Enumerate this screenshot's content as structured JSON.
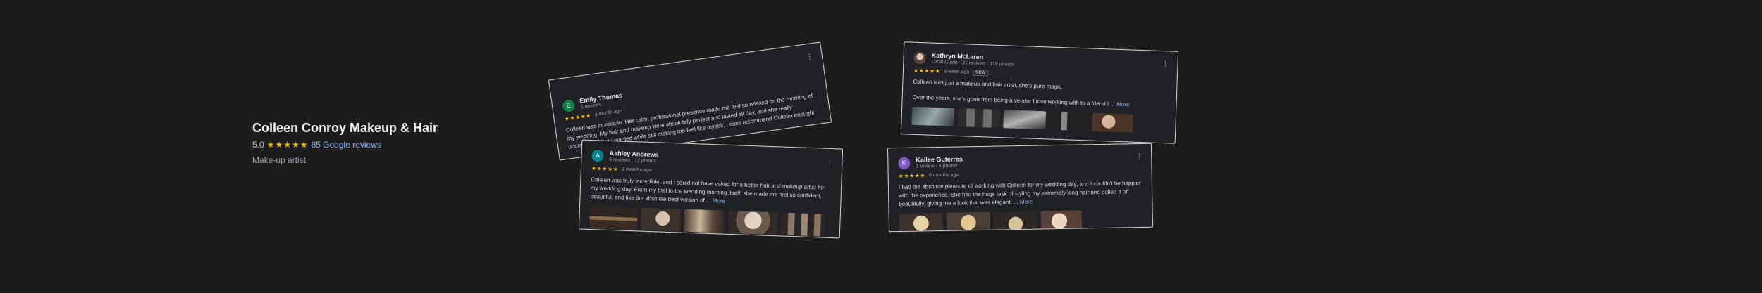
{
  "business": {
    "name": "Colleen Conroy Makeup & Hair",
    "rating": "5.0",
    "stars": "★★★★★",
    "reviews_link": "85 Google reviews",
    "category": "Make-up artist"
  },
  "reviews": [
    {
      "initial": "E",
      "avatar_color": "#0b8043",
      "name": "Emily Thomas",
      "meta": "5 reviews",
      "stars": "★★★★★",
      "date": "a month ago",
      "text": "Colleen was incredible. Her calm, professional presence made me feel so relaxed on the morning of my wedding. My hair and makeup were absolutely perfect and lasted all day, and she really understood what I wanted while still making me feel like myself. I can't recommend Colleen enough!",
      "more": ""
    },
    {
      "initial": "A",
      "avatar_color": "#00838f",
      "name": "Ashley Andrews",
      "meta": "6 reviews · 12 photos",
      "stars": "★★★★★",
      "date": "2 months ago",
      "text": "Colleen was truly incredible, and I could not have asked for a better hair and makeup artist for my wedding day. From my trial to the wedding morning itself, she made me feel so confident, beautiful, and like the absolute best version of ...",
      "more": "More"
    },
    {
      "initial": "",
      "avatar_color": "",
      "name": "Kathryn McLaren",
      "meta": "Local Guide · 31 reviews · 118 photos",
      "stars": "★★★★★",
      "date": "a week ago",
      "badge": "NEW",
      "text": "Colleen isn't just a makeup and hair artist, she's pure magic",
      "text2": "Over the years, she's gone from being a vendor I love working with to a friend I ...",
      "more": "More"
    },
    {
      "initial": "K",
      "avatar_color": "#7e57c2",
      "name": "Kailee Guterres",
      "meta": "1 review · 4 photos",
      "stars": "★★★★★",
      "date": "6 months ago",
      "text": "I had the absolute pleasure of working with Colleen for my wedding day, and I couldn't be happier with the experience. She had the huge task of styling my extremely long hair and pulled it off beautifully, giving me a look that was elegant, ...",
      "more": "More"
    }
  ],
  "icons": {
    "menu": "⋮"
  }
}
